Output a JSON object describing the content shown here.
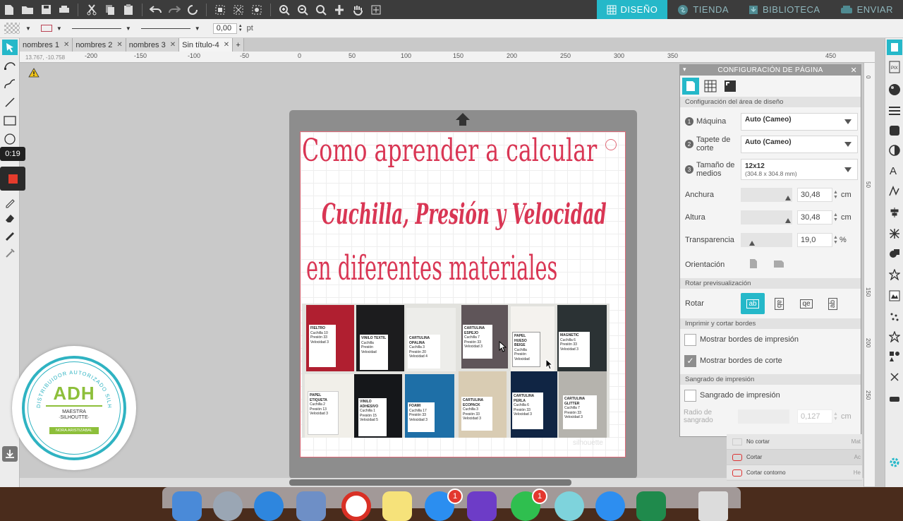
{
  "modes": [
    {
      "label": "DISEÑO",
      "icon": "grid-icon",
      "active": true
    },
    {
      "label": "TIENDA",
      "icon": "store-icon",
      "active": false
    },
    {
      "label": "BIBLIOTECA",
      "icon": "library-icon",
      "active": false
    },
    {
      "label": "ENVIAR",
      "icon": "send-icon",
      "active": false
    }
  ],
  "linebar": {
    "stroke_value": "0,00",
    "stroke_unit": "pt"
  },
  "tabs": [
    "nombres 1",
    "nombres 2",
    "nombres 3",
    "Sin título-4"
  ],
  "coords": "13.767, -10.758",
  "ruler_h": [
    "-200",
    "-150",
    "-100",
    "-50",
    "0",
    "50",
    "100",
    "150",
    "200",
    "250",
    "300",
    "350",
    "400",
    "450"
  ],
  "ruler_v": [
    "0",
    "50",
    "100",
    "150",
    "200",
    "250"
  ],
  "recorder": {
    "time": "0:19"
  },
  "canvas": {
    "title_line1": "Como aprender a calcular",
    "title_line2": "Cuchilla, Presión y Velocidad",
    "title_line3": "en diferentes materiales",
    "cards": [
      {
        "name": "FIELTRO",
        "lines": [
          "Cuchilla 10",
          "Presión 33",
          "Velocidad 3"
        ]
      },
      {
        "name": "VINILO TEXTIL",
        "lines": [
          "Cuchilla",
          "Presión",
          "Velocidad"
        ]
      },
      {
        "name": "CARTULINA OPALINA",
        "lines": [
          "Cuchilla 3",
          "Presión 20",
          "Velocidad 4"
        ]
      },
      {
        "name": "CARTULINA ESPEJO",
        "lines": [
          "Cuchilla 7",
          "Presión 33",
          "Velocidad 3"
        ]
      },
      {
        "name": "PAPEL HUESO BEIGE",
        "lines": [
          "Cuchilla",
          "Presión",
          "Velocidad"
        ]
      },
      {
        "name": "MAGNETIC",
        "lines": [
          "Cuchilla 6",
          "Presión 33",
          "Velocidad 3"
        ]
      },
      {
        "name": "PAPEL ETIQUETA",
        "lines": [
          "Cuchilla 2",
          "Presión 13",
          "Velocidad 3"
        ]
      },
      {
        "name": "VINILO ADHESIVO",
        "lines": [
          "Cuchilla 1",
          "Presión 15",
          "Velocidad 5"
        ]
      },
      {
        "name": "FOAMI",
        "lines": [
          "Cuchilla 17",
          "Presión 33",
          "Velocidad 3"
        ]
      },
      {
        "name": "CARTULINA ECOPACK",
        "lines": [
          "Cuchilla 3",
          "Presión 33",
          "Velocidad 3"
        ]
      },
      {
        "name": "CARTULINA PERLA",
        "lines": [
          "Cuchilla 6",
          "Presión 33",
          "Velocidad 3"
        ]
      },
      {
        "name": "CARTULINA GLITTER",
        "lines": [
          "Cuchilla 7",
          "Presión 33",
          "Velocidad 3"
        ]
      }
    ],
    "watermark": "silhouette"
  },
  "panel": {
    "title": "CONFIGURACIÓN DE PÁGINA",
    "section_design": "Configuración del área de diseño",
    "machine_label": "Máquina",
    "machine_value": "Auto (Cameo)",
    "mat_label_1": "Tapete de",
    "mat_label_2": "corte",
    "mat_value": "Auto (Cameo)",
    "media_label_1": "Tamaño de",
    "media_label_2": "medios",
    "media_value": "12x12",
    "media_sub": "(304.8 x 304.8 mm)",
    "width_label": "Anchura",
    "width_value": "30,48",
    "width_unit": "cm",
    "height_label": "Altura",
    "height_value": "30,48",
    "height_unit": "cm",
    "transparency_label": "Transparencia",
    "transparency_value": "19,0",
    "transparency_unit": "%",
    "orientation_label": "Orientación",
    "section_rotate": "Rotar previsualización",
    "rotate_label": "Rotar",
    "rotate_options": [
      "ab",
      "ab",
      "qe",
      "ab"
    ],
    "section_print": "Imprimir y cortar bordes",
    "show_print_borders": "Mostrar bordes de impresión",
    "show_print_checked": false,
    "show_cut_borders": "Mostrar bordes de corte",
    "show_cut_checked": true,
    "section_bleed": "Sangrado de impresión",
    "bleed_label": "Sangrado de impresión",
    "bleed_checked": false,
    "radius_label_1": "Radio de",
    "radius_label_2": "sangrado",
    "radius_value": "0,127",
    "radius_unit": "cm"
  },
  "below_panel": [
    {
      "label": "No cortar",
      "extra": "Mat"
    },
    {
      "label": "Cortar",
      "extra": "Ac"
    },
    {
      "label": "Cortar contorno",
      "extra": "He"
    }
  ],
  "logo": {
    "ring_text": "DISTRIBUIDOR AUTORIZADO SILHOUETTE",
    "brand": "ADH",
    "sub1": "MAESTRA",
    "sub2": "·SILHOUTTE·",
    "name": "NORA ARISTIZABAL"
  },
  "dock_badges": [
    "1",
    "1"
  ],
  "colors": {
    "accent": "#25b8c9",
    "title_red": "#d93654",
    "toolbar": "#3c3c3c"
  }
}
